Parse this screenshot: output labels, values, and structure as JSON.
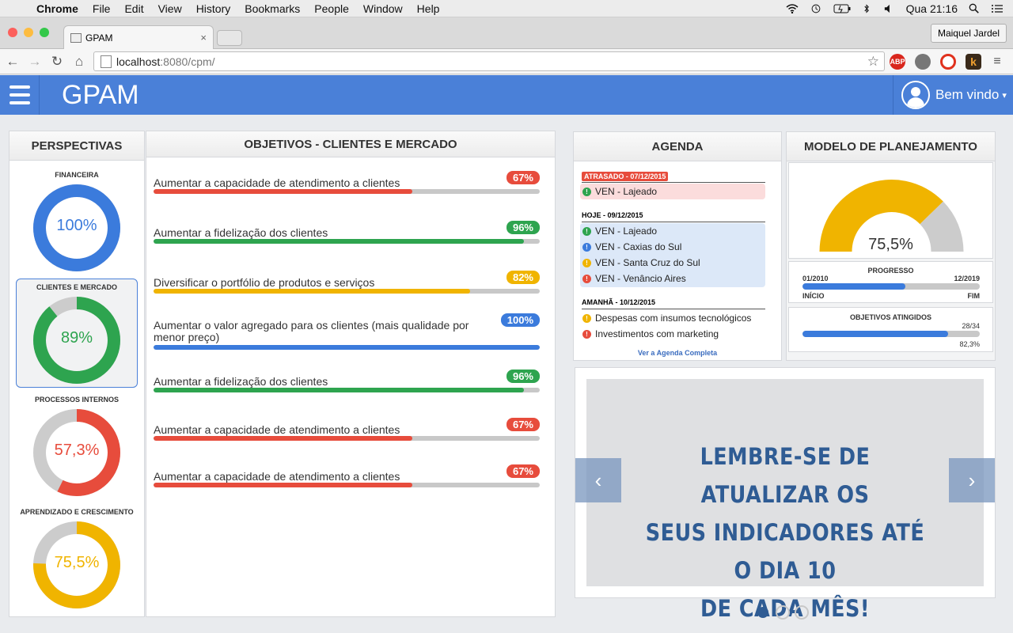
{
  "menubar": {
    "apple": "",
    "app": "Chrome",
    "items": [
      "File",
      "Edit",
      "View",
      "History",
      "Bookmarks",
      "People",
      "Window",
      "Help"
    ],
    "clock": "Qua 21:16"
  },
  "browser": {
    "tab_title": "GPAM",
    "tab_close": "×",
    "profile": "Maiquel Jardel",
    "url_host": "localhost",
    "url_rest": ":8080/cpm/",
    "back": "←",
    "forward": "→",
    "reload": "↻",
    "home": "⌂",
    "star": "☆",
    "extensions": [
      {
        "label": "ABP",
        "color": "#d9261c"
      },
      {
        "label": "",
        "color": "#777777"
      },
      {
        "label": "O",
        "color": "#e0311d"
      },
      {
        "label": "k",
        "color": "#b5651d"
      }
    ]
  },
  "app": {
    "brand": "GPAM",
    "welcome": "Bem vindo",
    "caret": "▾"
  },
  "perspectivas": {
    "title": "PERSPECTIVAS",
    "items": [
      {
        "name": "FINANCEIRA",
        "value": 100,
        "label": "100%",
        "color": "#3b7bdc"
      },
      {
        "name": "CLIENTES E MERCADO",
        "value": 89,
        "label": "89%",
        "color": "#2ea44f"
      },
      {
        "name": "PROCESSOS INTERNOS",
        "value": 57.3,
        "label": "57,3%",
        "color": "#e74c3c"
      },
      {
        "name": "APRENDIZADO E CRESCIMENTO",
        "value": 75.5,
        "label": "75,5%",
        "color": "#f0b400"
      }
    ]
  },
  "objetivos": {
    "title": "OBJETIVOS - CLIENTES E MERCADO",
    "items": [
      {
        "text": "Aumentar a capacidade de atendimento a clientes",
        "value": 67,
        "label": "67%",
        "color": "#e74c3c"
      },
      {
        "text": "Aumentar a fidelização dos clientes",
        "value": 96,
        "label": "96%",
        "color": "#2ea44f"
      },
      {
        "text": "Diversificar o portfólio de produtos e serviços",
        "value": 82,
        "label": "82%",
        "color": "#f0b400"
      },
      {
        "text": "Aumentar o valor agregado para os clientes (mais qualidade por menor preço)",
        "value": 100,
        "label": "100%",
        "color": "#3b7bdc"
      },
      {
        "text": "Aumentar a fidelização dos clientes",
        "value": 96,
        "label": "96%",
        "color": "#2ea44f"
      },
      {
        "text": "Aumentar a capacidade de atendimento a clientes",
        "value": 67,
        "label": "67%",
        "color": "#e74c3c"
      },
      {
        "text": "Aumentar a capacidade de atendimento a clientes",
        "value": 67,
        "label": "67%",
        "color": "#e74c3c"
      }
    ]
  },
  "agenda": {
    "title": "AGENDA",
    "late_label": "ATRASADO - 07/12/2015",
    "late_items": [
      {
        "text": "VEN - Lajeado",
        "color": "#2ea44f"
      }
    ],
    "today_label": "HOJE - 09/12/2015",
    "today_items": [
      {
        "text": "VEN - Lajeado",
        "color": "#2ea44f"
      },
      {
        "text": "VEN - Caxias do Sul",
        "color": "#3b7bdc"
      },
      {
        "text": "VEN - Santa Cruz do Sul",
        "color": "#f0b400"
      },
      {
        "text": "VEN - Venâncio Aires",
        "color": "#e74c3c"
      }
    ],
    "tomorrow_label": "AMANHÃ - 10/12/2015",
    "tomorrow_items": [
      {
        "text": "Despesas com insumos tecnológicos",
        "color": "#f0b400"
      },
      {
        "text": "Investimentos com marketing",
        "color": "#e74c3c"
      }
    ],
    "dot_glyph": "!",
    "link": "Ver a Agenda Completa"
  },
  "modelo": {
    "title": "MODELO DE PLANEJAMENTO",
    "gauge_value": 75.5,
    "gauge_label": "75,5%",
    "progresso_title": "PROGRESSO",
    "progresso_start": "01/2010",
    "progresso_end": "12/2019",
    "progresso_start_label": "INÍCIO",
    "progresso_end_label": "FIM",
    "progresso_value": 0.58,
    "objetivos_title": "OBJETIVOS ATINGIDOS",
    "objetivos_count": "28/34",
    "objetivos_pct": "82,3%",
    "objetivos_value": 0.823
  },
  "banner": {
    "lines": [
      "LEMBRE-SE DE ATUALIZAR OS",
      "SEUS INDICADORES ATÉ O DIA 10",
      "DE CADA MÊS!"
    ],
    "prev": "‹",
    "next": "›",
    "slides": 3,
    "active_slide": 1
  },
  "colors": {
    "primary": "#4a80d8",
    "green": "#2ea44f",
    "red": "#e74c3c",
    "yellow": "#f0b400",
    "blue": "#3b7bdc"
  }
}
